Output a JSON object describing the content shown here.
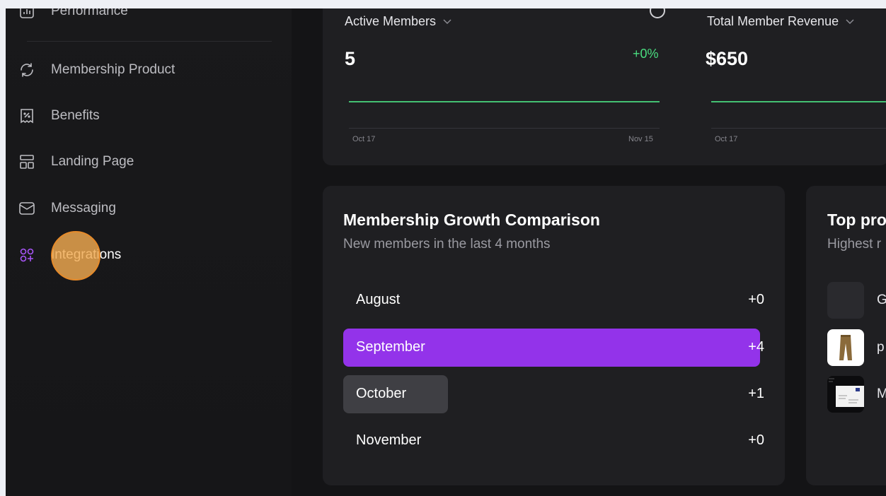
{
  "sidebar": {
    "items": [
      {
        "label": "Performance",
        "icon": "chart-icon"
      },
      {
        "label": "Membership Product",
        "icon": "refresh-icon"
      },
      {
        "label": "Benefits",
        "icon": "discount-receipt-icon"
      },
      {
        "label": "Landing Page",
        "icon": "layout-icon"
      },
      {
        "label": "Messaging",
        "icon": "mail-icon"
      },
      {
        "label": "Integrations",
        "icon": "apps-add-icon"
      }
    ]
  },
  "stats": [
    {
      "title": "Active Members",
      "value": "5",
      "delta": "+0%",
      "x_start": "Oct 17",
      "x_end": "Nov 15"
    },
    {
      "title": "Total Member Revenue",
      "value": "$650",
      "x_start": "Oct 17"
    }
  ],
  "growth": {
    "title": "Membership Growth Comparison",
    "subtitle": "New members in the last 4 months",
    "rows": [
      {
        "month": "August",
        "count": "+0",
        "fill": 0
      },
      {
        "month": "September",
        "count": "+4",
        "fill": 1.0
      },
      {
        "month": "October",
        "count": "+1",
        "fill": 0.25
      },
      {
        "month": "November",
        "count": "+0",
        "fill": 0
      }
    ]
  },
  "top_products": {
    "title": "Top pro",
    "subtitle": "Highest r",
    "items": [
      {
        "name": "G"
      },
      {
        "name": "p"
      },
      {
        "name": "M"
      }
    ]
  },
  "colors": {
    "accent": "#9333ea",
    "positive": "#4ade80",
    "active_nav": "#ffffff"
  }
}
